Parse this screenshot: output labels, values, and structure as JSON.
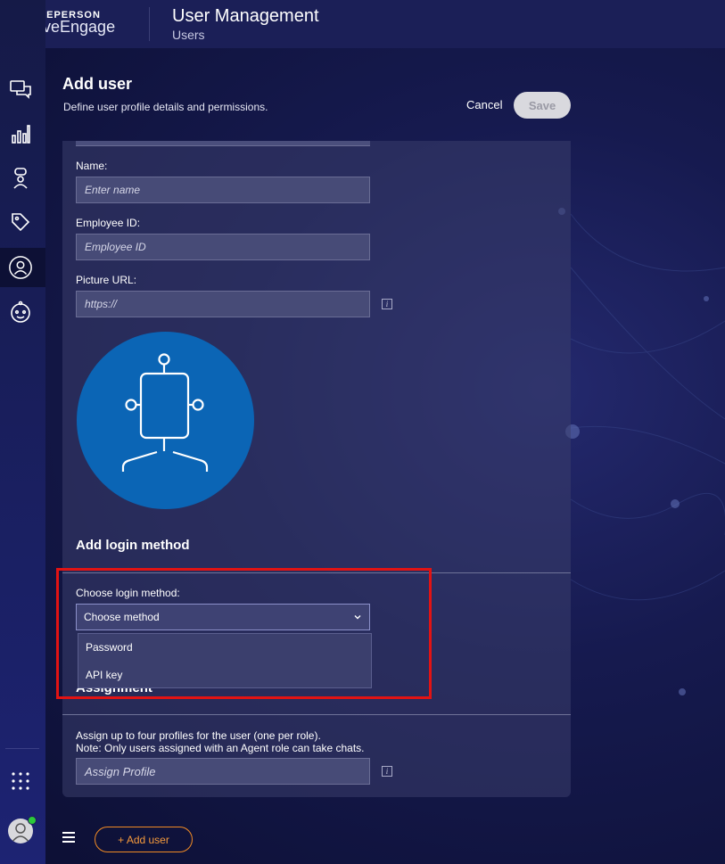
{
  "brand": {
    "company": "LIVEPERSON",
    "product": "LiveEngage"
  },
  "header": {
    "title": "User Management",
    "subtitle": "Users"
  },
  "page": {
    "title": "Add user",
    "description": "Define user profile details and permissions.",
    "cancel_label": "Cancel",
    "save_label": "Save"
  },
  "form": {
    "name": {
      "label": "Name:",
      "placeholder": "Enter name"
    },
    "employee_id": {
      "label": "Employee ID:",
      "placeholder": "Employee ID"
    },
    "picture_url": {
      "label": "Picture URL:",
      "placeholder": "https://"
    },
    "info_glyph": "i"
  },
  "login": {
    "section_title": "Add login method",
    "label": "Choose login method:",
    "selected": "Choose method",
    "options": [
      "Password",
      "API key"
    ]
  },
  "assignment": {
    "section_title": "Assignment",
    "line1": "Assign up to four profiles for the user (one per role).",
    "line2": "Note: Only users assigned with an Agent role can take chats.",
    "placeholder": "Assign Profile"
  },
  "footer": {
    "add_user_label": "+ Add user"
  },
  "colors": {
    "accent_orange": "#f08a24",
    "highlight_red": "#e21313",
    "online_green": "#2bc93a",
    "avatar_blue": "#0b65b5"
  },
  "icons": {
    "nav": [
      "conversations-icon",
      "analytics-icon",
      "agent-icon",
      "tag-icon",
      "users-icon",
      "bot-icon",
      "apps-grid-icon"
    ],
    "default_avatar": "robot-avatar-icon"
  }
}
